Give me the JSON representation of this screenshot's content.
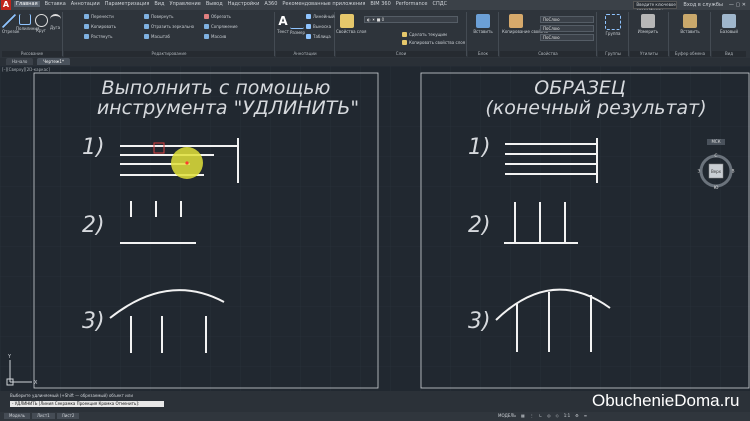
{
  "titlebar": {
    "menu": [
      "Главная",
      "Вставка",
      "Аннотации",
      "Параметризация",
      "Вид",
      "Управление",
      "Вывод",
      "Надстройки",
      "A360",
      "Рекомендованные приложения",
      "BIM 360",
      "Performance",
      "СПДС"
    ],
    "search_placeholder": "Введите ключевое слово/фразу",
    "login": "Вход в службы"
  },
  "ribbon": {
    "draw": {
      "label": "Рисование",
      "buttons": [
        "Отрезок",
        "Полилиния",
        "Круг",
        "Дуга"
      ]
    },
    "modify": {
      "label": "Редактирование",
      "items": [
        "Перенести",
        "Повернуть",
        "Обрезать",
        "Копировать",
        "Отразить зеркально",
        "Сопряжение",
        "Растянуть",
        "Масштаб",
        "Массив"
      ]
    },
    "annotation": {
      "label": "Аннотации",
      "buttons": [
        "Текст",
        "Размер"
      ],
      "items": [
        "Линейный",
        "Выноска",
        "Таблица"
      ]
    },
    "layers": {
      "label": "Слои",
      "buttons": [
        "Свойства слоя"
      ],
      "items": [
        "Сделать текущим",
        "Копировать свойства слоя"
      ]
    },
    "block": {
      "label": "Блок",
      "buttons": [
        "Вставить"
      ]
    },
    "properties": {
      "label": "Свойства",
      "buttons": [
        "Копирование свойств"
      ],
      "fields": [
        "ПоСлою",
        "ПоСлою",
        "ПоСлою"
      ]
    },
    "groups": {
      "label": "Группы",
      "buttons": [
        "Группа"
      ]
    },
    "utilities": {
      "label": "Утилиты",
      "buttons": [
        "Измерить"
      ]
    },
    "clipboard": {
      "label": "Буфер обмена",
      "buttons": [
        "Вставить"
      ]
    },
    "view": {
      "label": "Вид",
      "buttons": [
        "Базовый"
      ]
    }
  },
  "file_tabs": [
    "Начало",
    "Чертеж1*"
  ],
  "viewport_label": "[–][Сверху][2D-каркас]",
  "drawing": {
    "left_title_1": "Выполнить с помощью",
    "left_title_2": "инструмента \"УДЛИНИТЬ\"",
    "right_title_1": "ОБРАЗЕЦ",
    "right_title_2": "(конечный результат)",
    "labels_left": [
      "1)",
      "2)",
      "3)"
    ],
    "labels_right": [
      "1)",
      "2)",
      "3)"
    ]
  },
  "navcube": {
    "top": "Верх",
    "north": "С",
    "south": "Ю",
    "west": "З",
    "east": "В",
    "wcs": "МСК"
  },
  "ucs": {
    "y": "Y",
    "x": "X"
  },
  "command": {
    "history": "Выберите удлиняемый (+Shift — обрезаемый) объект или",
    "prompt": "- УДЛИНИТЬ [Линия Секрамка Проекция Кромка Отменить]:"
  },
  "status": {
    "tabs": [
      "Модель",
      "Лист1",
      "Лист2"
    ],
    "model": "МОДЕЛЬ",
    "scale": "1:1"
  },
  "watermark": "ObuchenieDoma.ru"
}
